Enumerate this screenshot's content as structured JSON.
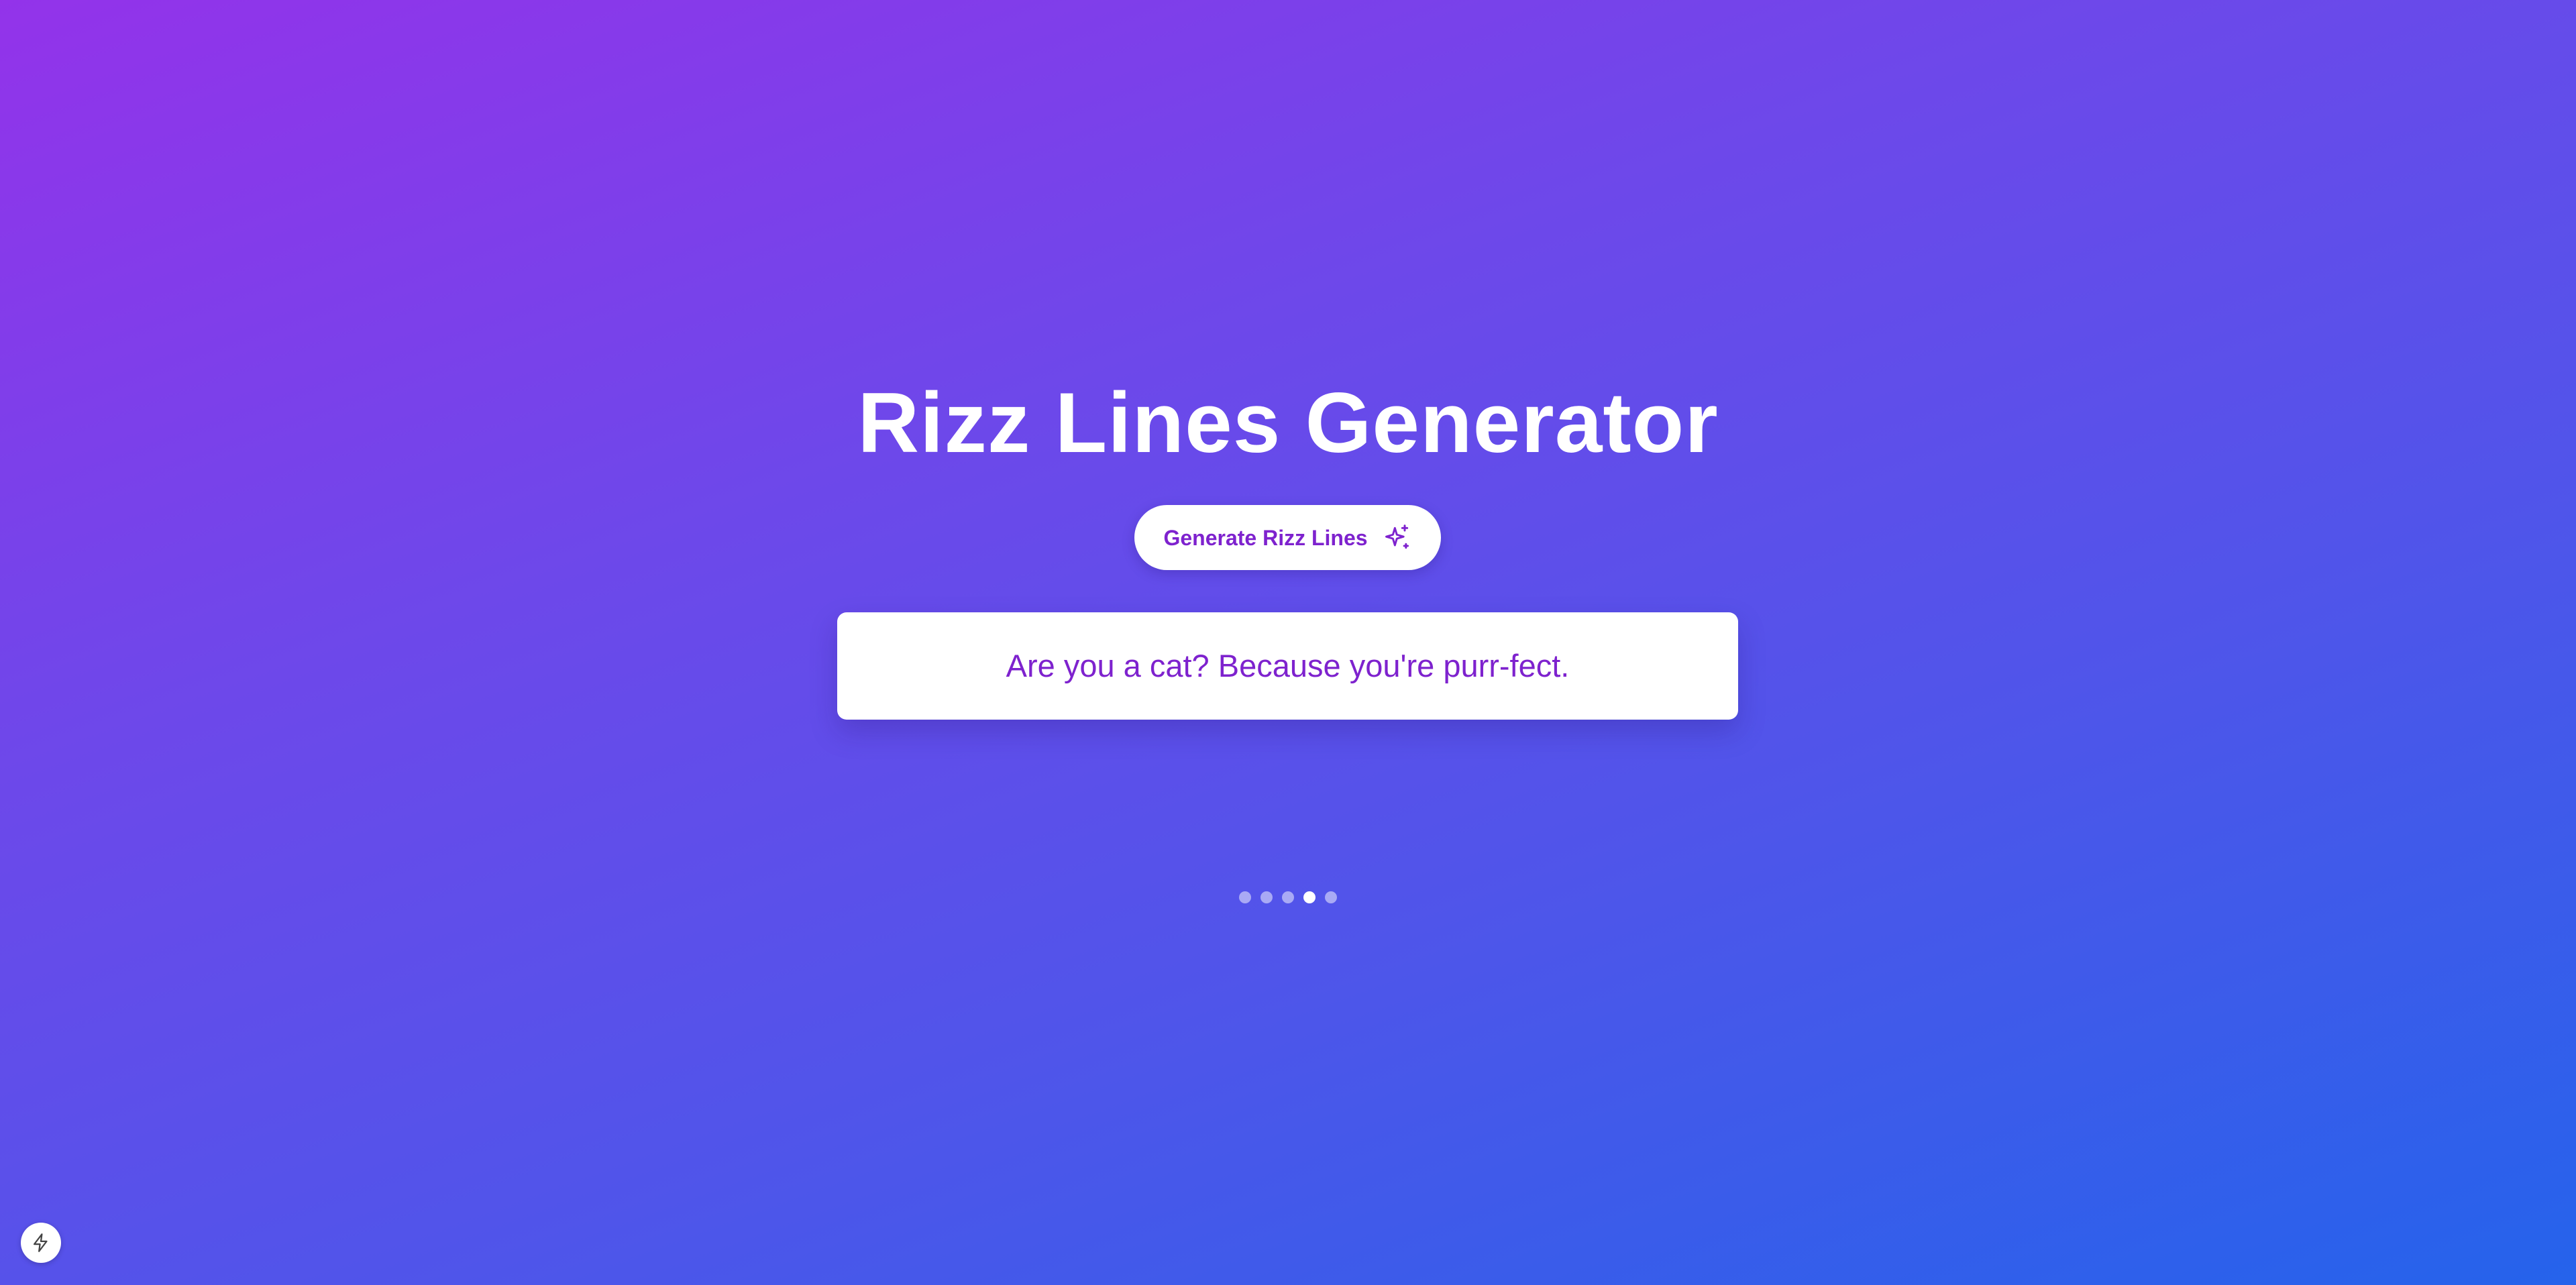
{
  "page": {
    "title": "Rizz Lines Generator",
    "background_colors": [
      "#9333ea",
      "#2563eb"
    ]
  },
  "generate_button": {
    "label": "Generate Rizz Lines",
    "icon": "sparkles-icon",
    "color": "#7e22ce"
  },
  "current_line": {
    "text": "Are you a cat? Because you're purr-fect."
  },
  "pagination": {
    "total": 5,
    "active_index": 3
  },
  "corner_button": {
    "icon": "bolt-icon"
  }
}
